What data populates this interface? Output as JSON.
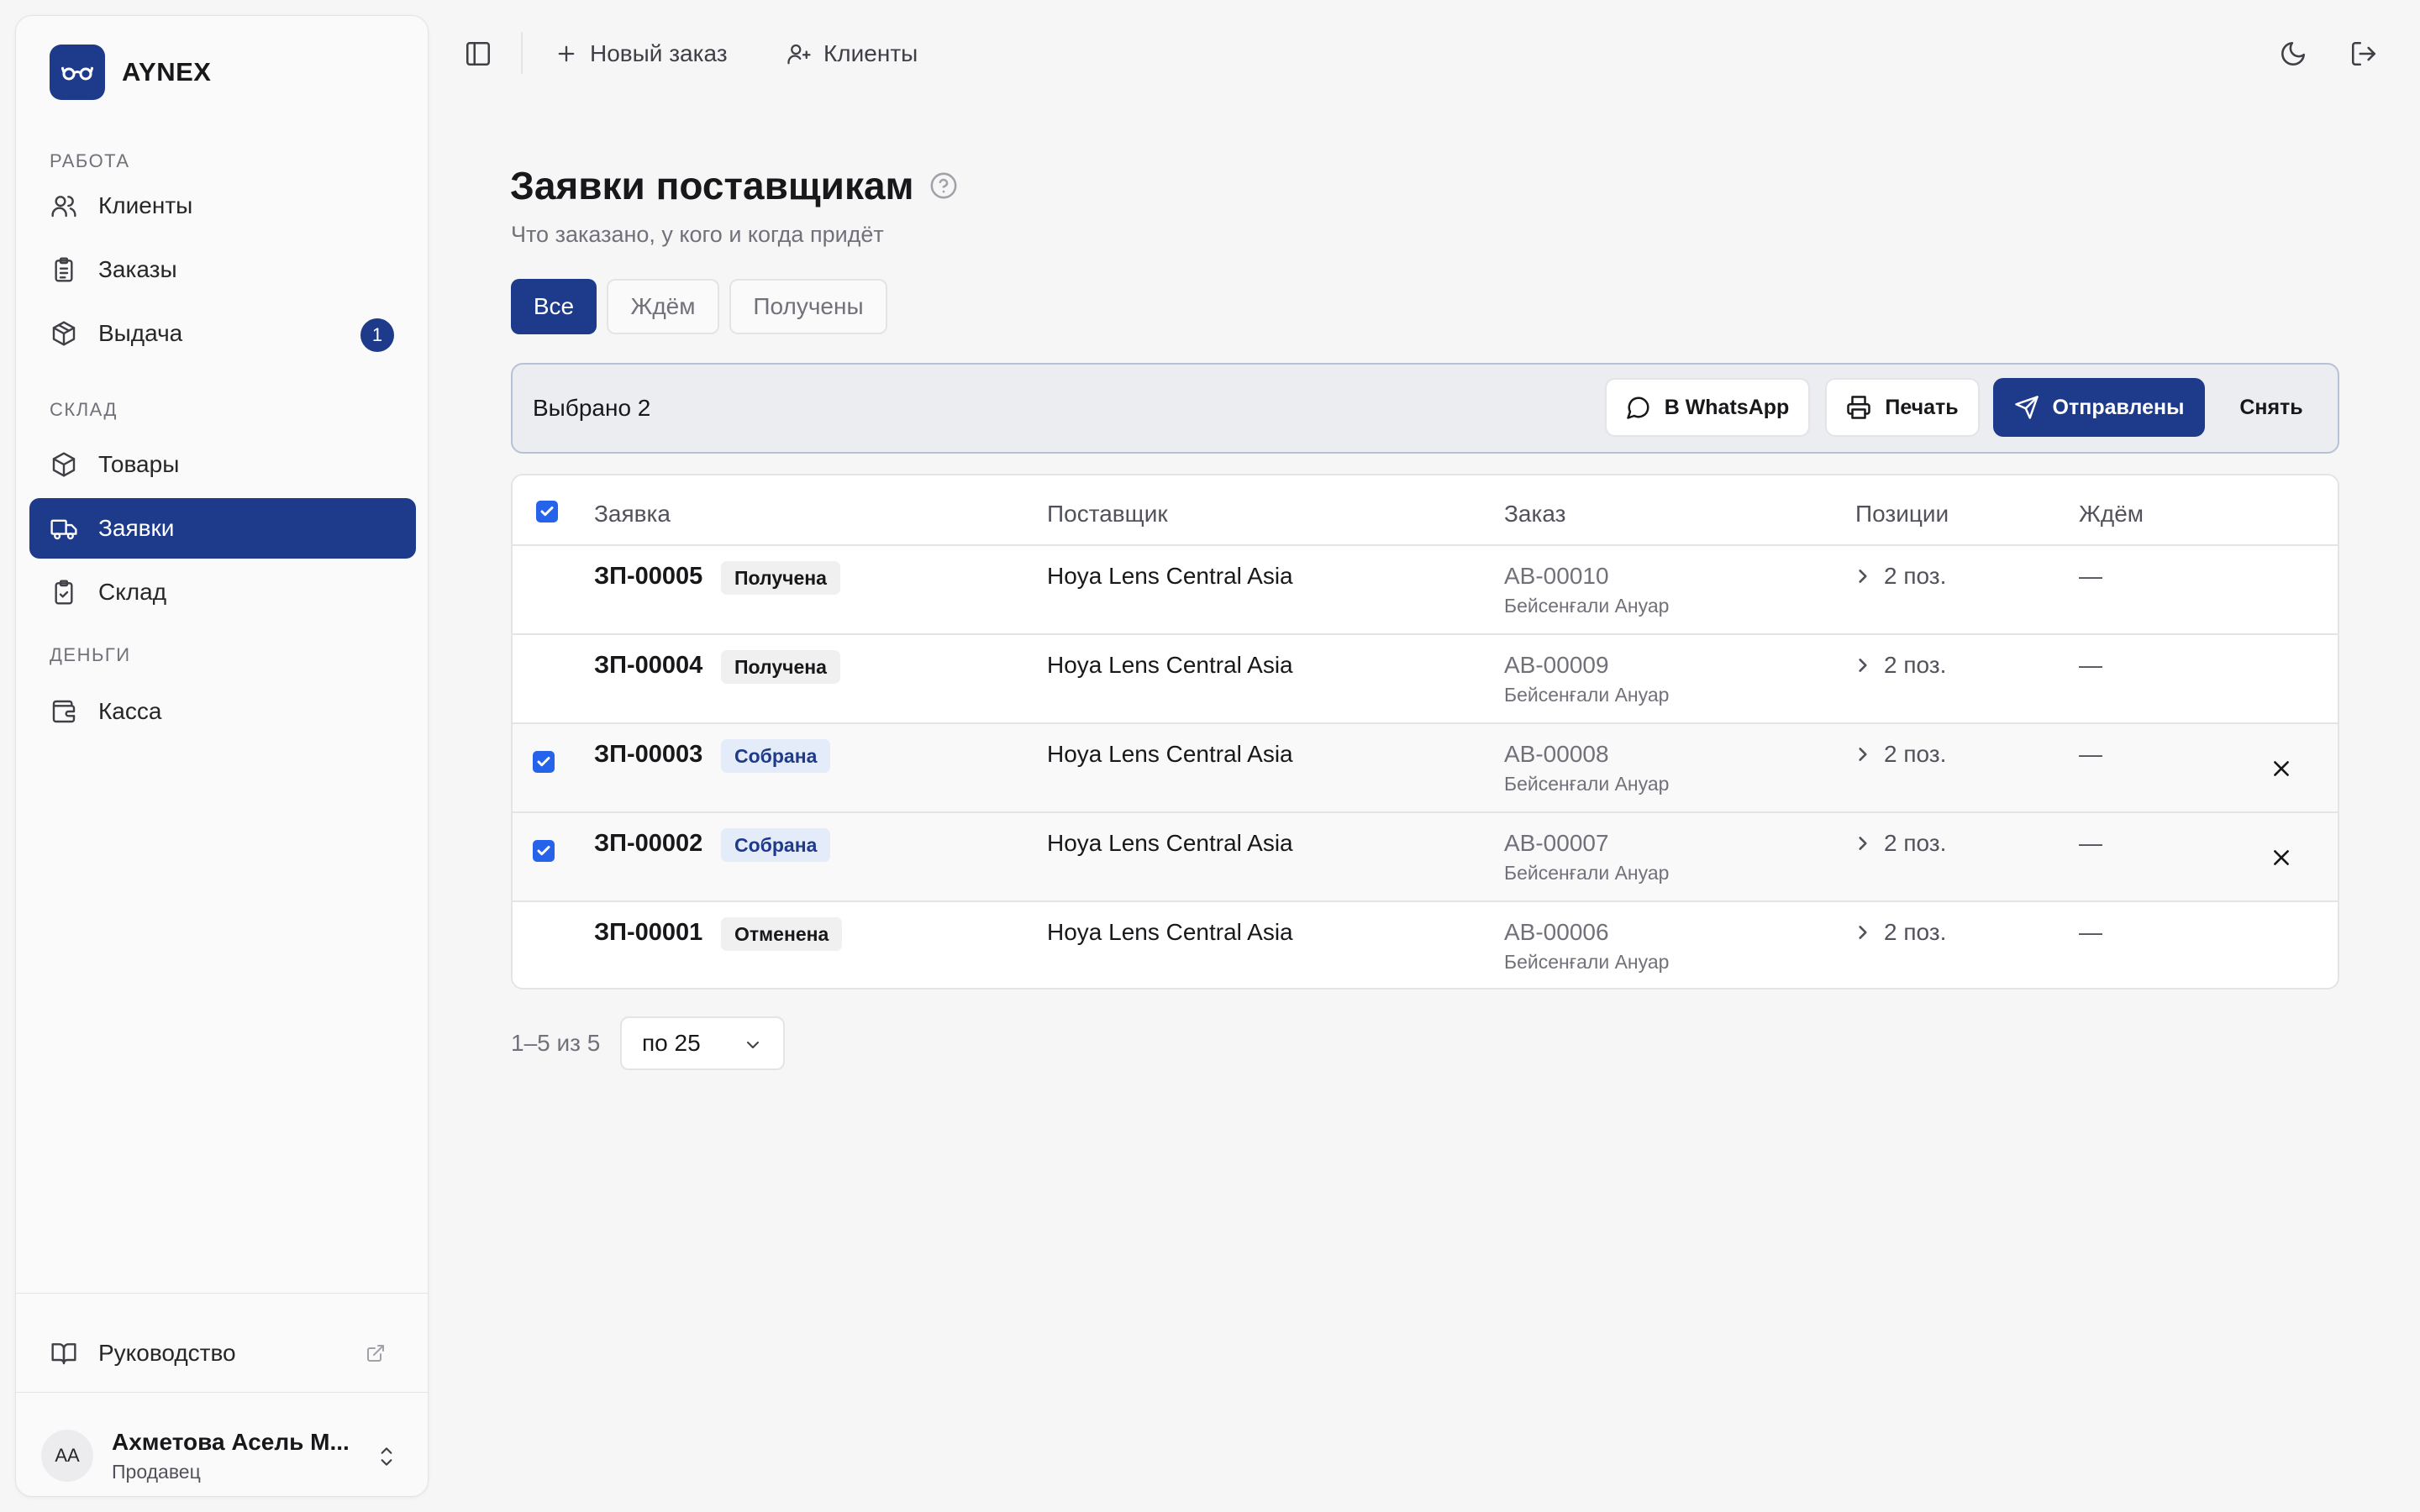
{
  "app": {
    "name": "AYNEX"
  },
  "sidebar": {
    "sections": [
      {
        "label": "РАБОТА"
      },
      {
        "label": "СКЛАД"
      },
      {
        "label": "ДЕНЬГИ"
      }
    ],
    "items": [
      {
        "label": "Клиенты",
        "icon": "users-icon"
      },
      {
        "label": "Заказы",
        "icon": "clipboard-list-icon"
      },
      {
        "label": "Выдача",
        "icon": "package-icon",
        "badge": "1"
      },
      {
        "label": "Товары",
        "icon": "box-icon"
      },
      {
        "label": "Заявки",
        "icon": "truck-icon",
        "active": true
      },
      {
        "label": "Склад",
        "icon": "clipboard-check-icon"
      },
      {
        "label": "Касса",
        "icon": "wallet-icon"
      }
    ],
    "guide": {
      "label": "Руководство"
    },
    "user": {
      "initials": "АА",
      "name": "Ахметова Асель М...",
      "role": "Продавец"
    }
  },
  "topbar": {
    "new_order": "Новый заказ",
    "clients": "Клиенты"
  },
  "page": {
    "title": "Заявки поставщикам",
    "subtitle": "Что заказано, у кого и когда придёт"
  },
  "tabs": [
    {
      "label": "Все",
      "active": true
    },
    {
      "label": "Ждём",
      "active": false
    },
    {
      "label": "Получены",
      "active": false
    }
  ],
  "action_bar": {
    "selected": "Выбрано 2",
    "whatsapp": "В WhatsApp",
    "print": "Печать",
    "sent": "Отправлены",
    "clear": "Снять"
  },
  "table": {
    "headers": {
      "request": "Заявка",
      "supplier": "Поставщик",
      "order": "Заказ",
      "positions": "Позиции",
      "waiting": "Ждём"
    },
    "rows": [
      {
        "id": "ЗП-00005",
        "status": "Получена",
        "supplier": "Hoya Lens Central Asia",
        "order": "АВ-00010",
        "client": "Бейсенғали Ануар",
        "positions": "2 поз.",
        "waiting": "—",
        "selected": false
      },
      {
        "id": "ЗП-00004",
        "status": "Получена",
        "supplier": "Hoya Lens Central Asia",
        "order": "АВ-00009",
        "client": "Бейсенғали Ануар",
        "positions": "2 поз.",
        "waiting": "—",
        "selected": false
      },
      {
        "id": "ЗП-00003",
        "status": "Собрана",
        "supplier": "Hoya Lens Central Asia",
        "order": "АВ-00008",
        "client": "Бейсенғали Ануар",
        "positions": "2 поз.",
        "waiting": "—",
        "selected": true
      },
      {
        "id": "ЗП-00002",
        "status": "Собрана",
        "supplier": "Hoya Lens Central Asia",
        "order": "АВ-00007",
        "client": "Бейсенғали Ануар",
        "positions": "2 поз.",
        "waiting": "—",
        "selected": true
      },
      {
        "id": "ЗП-00001",
        "status": "Отменена",
        "supplier": "Hoya Lens Central Asia",
        "order": "АВ-00006",
        "client": "Бейсенғали Ануар",
        "positions": "2 поз.",
        "waiting": "—",
        "selected": false
      }
    ]
  },
  "pagination": {
    "info": "1–5 из 5",
    "per_page": "по 25"
  },
  "colors": {
    "brand": "#1e3a8a",
    "checkbox": "#2563eb",
    "background": "#f6f6f7"
  }
}
